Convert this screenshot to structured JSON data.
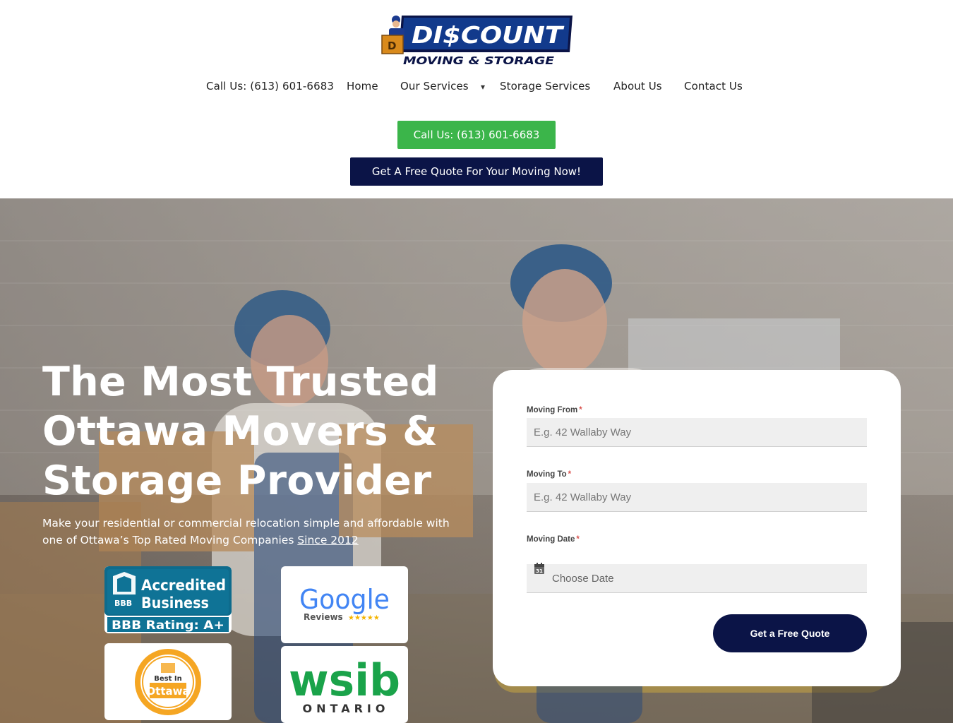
{
  "brand": {
    "logo_top": "DI$COUNT",
    "logo_bottom": "MOVING & STORAGE",
    "logo_box_letter": "D",
    "colors": {
      "navy": "#0b1447",
      "green": "#3bb54a",
      "logo_blue": "#123a8c"
    }
  },
  "nav": {
    "call": "Call Us: (613) 601-6683",
    "home": "Home",
    "services": "Our Services",
    "services_caret": "▾",
    "storage": "Storage Services",
    "about": "About Us",
    "contact": "Contact Us"
  },
  "cta": {
    "call_label": "Call Us: (613) 601-6683",
    "quote_label": "Get A Free Quote For Your Moving Now!"
  },
  "hero": {
    "title_line1": "The Most Trusted",
    "title_line2": "Ottawa Movers &",
    "title_line3": "Storage Provider",
    "subtitle": "Make your residential or commercial relocation simple and affordable with one of Ottawa’s Top Rated Moving Companies ",
    "since": "Since 2012"
  },
  "badges": {
    "bbb": {
      "line1": "Accredited",
      "line2": "Business",
      "rating": "BBB Rating: A+",
      "mark": "BBB"
    },
    "google": {
      "word": "Google",
      "reviews": "Reviews",
      "stars": "★★★★★"
    },
    "ottawa": {
      "line1": "Best In",
      "line2": "Ottawa"
    },
    "wsib": {
      "word": "wsib",
      "region": "ONTARIO"
    }
  },
  "form": {
    "from_label": "Moving From",
    "from_placeholder": "E.g. 42 Wallaby Way",
    "to_label": "Moving To",
    "to_placeholder": "E.g. 42 Wallaby Way",
    "date_label": "Moving Date",
    "date_placeholder": "Choose Date",
    "required_mark": "*",
    "calendar_day": "31",
    "submit": "Get a Free Quote"
  }
}
